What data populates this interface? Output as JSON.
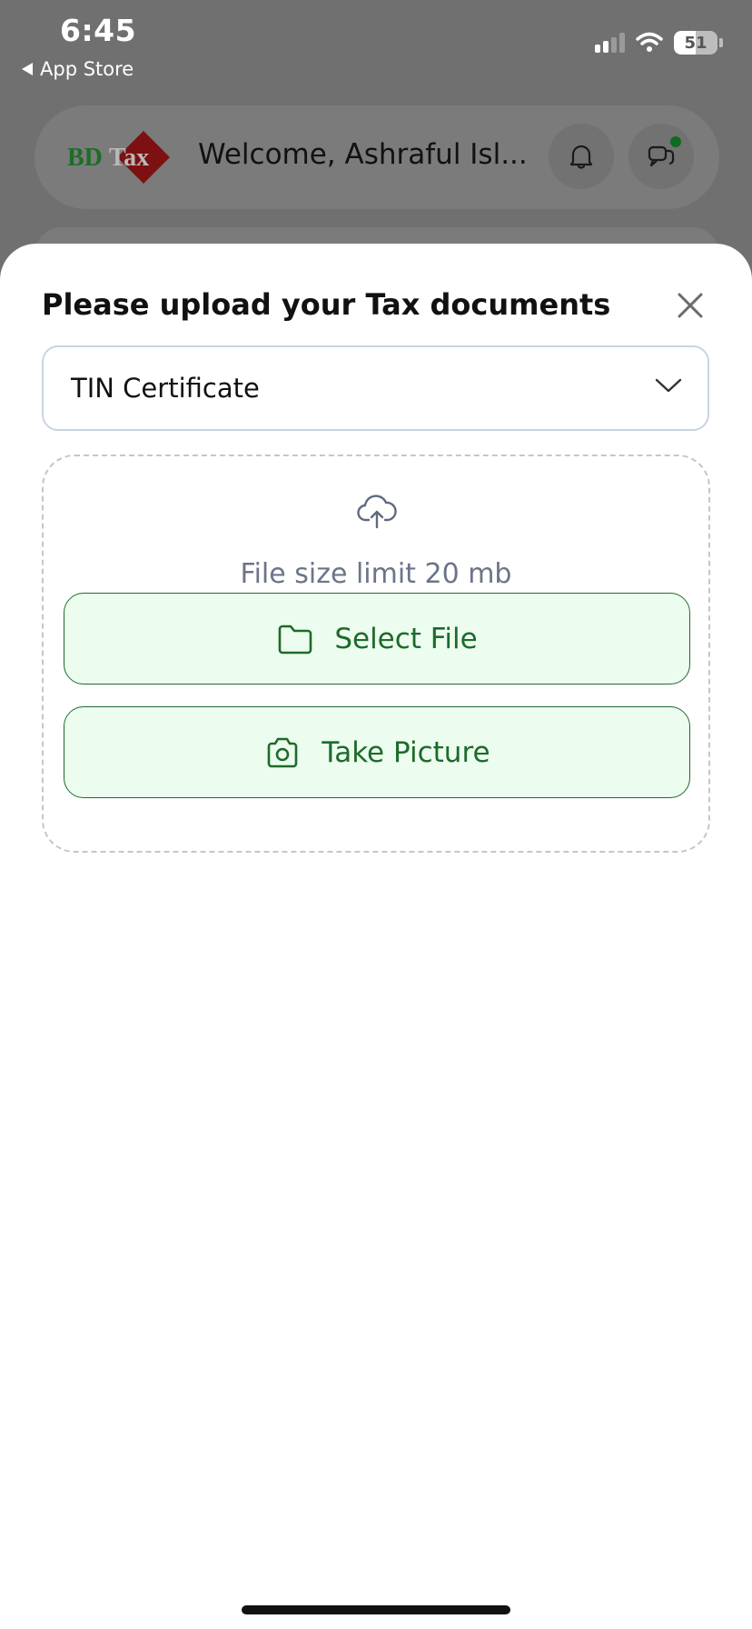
{
  "status_bar": {
    "time": "6:45",
    "back_label": "App Store",
    "battery_level": 51,
    "battery_label": "51"
  },
  "header": {
    "logo_text_bd": "BD",
    "logo_text_tax": "Tax",
    "welcome_text": "Welcome, Ashraful Isl...",
    "chat_unread": true
  },
  "sheet": {
    "title": "Please upload your Tax documents",
    "document_type": {
      "selected": "TIN Certificate"
    },
    "upload": {
      "limit_text": "File size limit 20 mb",
      "select_file_label": "Select File",
      "take_picture_label": "Take Picture"
    }
  },
  "colors": {
    "accent_green": "#1d6a2b",
    "button_bg": "#ecfcef",
    "logo_red": "#8b0f12",
    "logo_green": "#1d7a2a"
  },
  "icons": {
    "close": "close-icon",
    "chevron": "chevron-down-icon",
    "upload": "cloud-upload-icon",
    "folder": "folder-icon",
    "camera": "camera-icon",
    "bell": "bell-icon",
    "chat": "chat-icon"
  }
}
